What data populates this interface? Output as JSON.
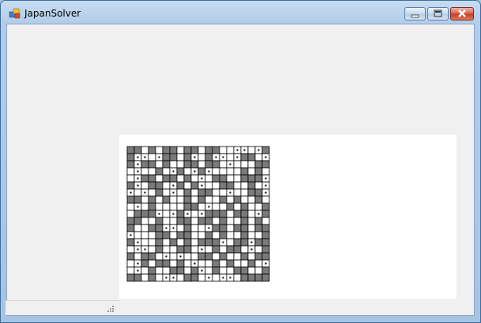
{
  "window": {
    "title": "JapanSolver"
  },
  "colors": {
    "filled": "#7a7a7a",
    "empty": "#ffffff",
    "dot": "#000000",
    "gridline": "#000000"
  },
  "puzzle": {
    "rows": 19,
    "cols": 20,
    "cell_legend": {
      "#": "filled",
      ".": "dot",
      " ": "empty"
    },
    "grid": [
      "## # ## ## ##  .. .#",
      "#.. .## #. #.. .## .",
      "#.## #  ## ## .   ##",
      " .  # .# .#.    # # ",
      " .## ## # . ##  ###.",
      "#. ## .# #.  ##  # .",
      ". . # . # ##  .  ##.",
      "## # #  # #  # #  # ",
      " . #    ## .  # #  #",
      " ###. .#. .### ## .#",
      "##  #  ## ## #  # # ",
      "#  ##.. #  .## ## ##",
      ".   ## ##  # #  #  #",
      "#.  # # # ###. ##.##",
      " .. #  ## . # ## . #",
      "# ## . .  ## #  # ##",
      " .# ## # .  # #  # .",
      " . #  ## #. #  ##  #",
      "## # .. ## . .. ####"
    ]
  }
}
